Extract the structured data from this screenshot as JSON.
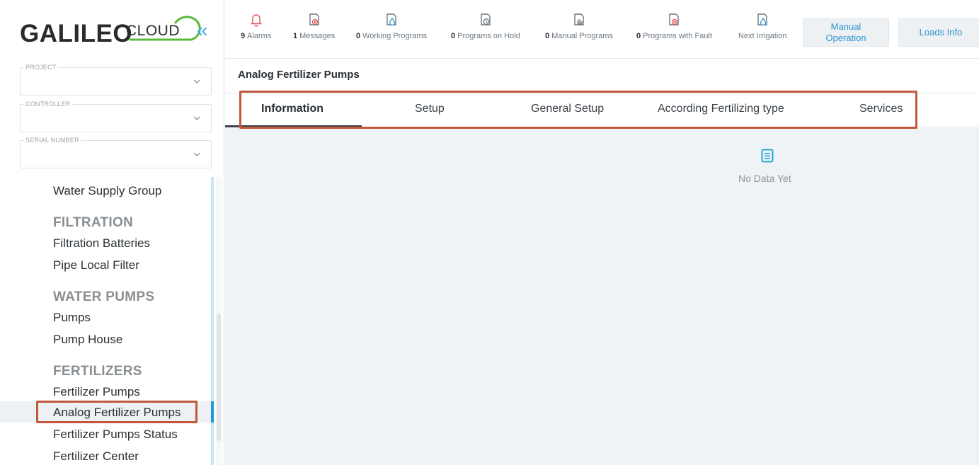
{
  "brand": {
    "name": "GALILEO",
    "cloud": "CLOUD"
  },
  "sidebar": {
    "collapse_glyph": "«",
    "fields": [
      {
        "legend": "PROJECT",
        "value": ""
      },
      {
        "legend": "CONTROLLER",
        "value": ""
      },
      {
        "legend": "SERIAL NUMBER",
        "value": ""
      }
    ],
    "nav": [
      {
        "type": "item",
        "label": "Water Supply Group"
      },
      {
        "type": "section",
        "label": "FILTRATION"
      },
      {
        "type": "item",
        "label": "Filtration Batteries"
      },
      {
        "type": "item",
        "label": "Pipe Local Filter"
      },
      {
        "type": "section",
        "label": "WATER PUMPS"
      },
      {
        "type": "item",
        "label": "Pumps"
      },
      {
        "type": "item",
        "label": "Pump House"
      },
      {
        "type": "section",
        "label": "FERTILIZERS"
      },
      {
        "type": "item",
        "label": "Fertilizer Pumps"
      },
      {
        "type": "item",
        "label": "Analog Fertilizer Pumps",
        "active": true
      },
      {
        "type": "item",
        "label": "Fertilizer Pumps Status"
      },
      {
        "type": "item",
        "label": "Fertilizer Center"
      }
    ]
  },
  "topbar": {
    "stats": [
      {
        "count": "9",
        "label": "Alarms",
        "icon": "bell-icon",
        "color": "#e05555"
      },
      {
        "count": "1",
        "label": "Messages",
        "icon": "message-error-icon",
        "color": "#e05555"
      },
      {
        "count": "0",
        "label": "Working Programs",
        "icon": "program-drop-icon",
        "color": "#2d95cf"
      },
      {
        "count": "0",
        "label": "Programs on Hold",
        "icon": "program-clock-icon",
        "color": "#6c7780"
      },
      {
        "count": "0",
        "label": "Manual Programs",
        "icon": "program-hand-icon",
        "color": "#6c7780"
      },
      {
        "count": "0",
        "label": "Programs with Fault",
        "icon": "program-fault-icon",
        "color": "#e05555"
      },
      {
        "count": "",
        "label": "Next Irrigation",
        "icon": "next-irrigation-icon",
        "color": "#2d95cf"
      }
    ],
    "manual_operation": "Manual Operation",
    "loads_info": "Loads Info"
  },
  "main": {
    "title": "Analog Fertilizer Pumps",
    "tabs": [
      {
        "label": "Information",
        "active": true
      },
      {
        "label": "Setup"
      },
      {
        "label": "General Setup"
      },
      {
        "label": "According Fertilizing type"
      },
      {
        "label": "Services"
      }
    ],
    "empty_text": "No Data Yet"
  },
  "colors": {
    "accent": "#2d95cf",
    "alert": "#e05555",
    "highlight": "#c2583b",
    "content_bg": "#eef3f6"
  }
}
